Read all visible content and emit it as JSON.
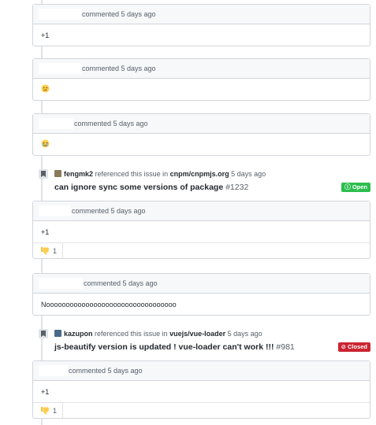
{
  "comments": [
    {
      "header": "commented 5 days ago",
      "body": "+1"
    },
    {
      "header": "commented 5 days ago",
      "emoji": "confused-face"
    },
    {
      "header": "commented 5 days ago",
      "emoji": "crying-face"
    },
    {
      "header": "commented 5 days ago",
      "body": "+1",
      "reaction": {
        "emoji": "thumbs-down",
        "count": "1"
      }
    },
    {
      "header": "commented 5 days ago",
      "body": "Nooooooooooooooooooooooooooooooooo"
    },
    {
      "header": "commented 5 days ago",
      "body": "+1",
      "reaction": {
        "emoji": "thumbs-down",
        "count": "1"
      }
    }
  ],
  "events": [
    {
      "user": "fengmk2",
      "action": "referenced this issue in",
      "repo": "cnpm/cnpmjs.org",
      "time": "5 days ago",
      "title": "can ignore sync some versions of package",
      "number": "#1232",
      "state": "Open",
      "state_color": "#2cbe4e"
    },
    {
      "user": "kazupon",
      "action": "referenced this issue in",
      "repo": "vuejs/vue-loader",
      "time": "5 days ago",
      "title": "js-beautify version is updated ! vue-loader can't work !!!",
      "number": "#981",
      "state": "Closed",
      "state_color": "#cb2431"
    }
  ],
  "colors": {
    "link": "#0366d6",
    "border": "#d1d5da",
    "header_bg": "#f6f8fa"
  }
}
